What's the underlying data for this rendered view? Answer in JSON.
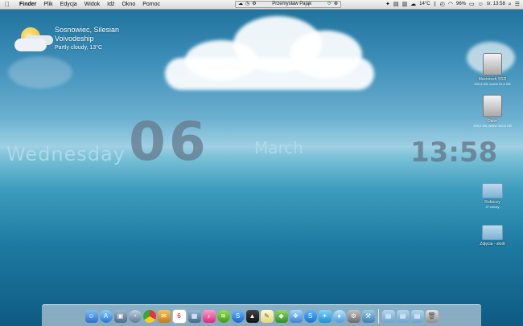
{
  "menubar": {
    "apple_icon": "apple-logo-icon",
    "menus": [
      "Finder",
      "Plik",
      "Edycja",
      "Widok",
      "Idź",
      "Okno",
      "Pomoc"
    ],
    "chat": {
      "name": "Przemysław Pająk"
    },
    "status": {
      "temperature": "14°C",
      "battery": "96%",
      "datetime": "śr. 13:58"
    }
  },
  "weather": {
    "location_line1": "Sosnowiec, Silesian",
    "location_line2": "Voivodeship",
    "condition": "Partly cloudy, 13°C"
  },
  "clock": {
    "weekday": "Wednesday",
    "day": "06",
    "month": "March",
    "time": "13:58"
  },
  "desktop_icons": [
    {
      "label": "Macintosh SSD",
      "sub": "250,4 GB, wolne 94,9 GB",
      "kind": "drive"
    },
    {
      "label": "Dane",
      "sub": "499,9 GB, wolne 152,8 GB",
      "kind": "drive"
    },
    {
      "label": "Roboczy",
      "sub": "47 rzeczy",
      "kind": "folder"
    },
    {
      "label": "Zdjęcia - skrót",
      "sub": "",
      "kind": "folder"
    }
  ],
  "dock": {
    "icons": [
      "finder-icon",
      "app-store-icon",
      "preview-icon",
      "dashboard-icon",
      "chrome-icon",
      "sparrow-icon",
      "calendar-icon",
      "photos-icon",
      "itunes-icon",
      "spotify-icon",
      "skype-icon",
      "stocks-icon",
      "notes-icon",
      "evernote-icon",
      "dropbox-icon",
      "skype-icon",
      "twitter-icon",
      "messages-icon",
      "system-prefs-icon",
      "utilities-icon",
      "apps-folder-icon",
      "downloads-folder-icon",
      "documents-folder-icon",
      "trash-icon"
    ]
  }
}
